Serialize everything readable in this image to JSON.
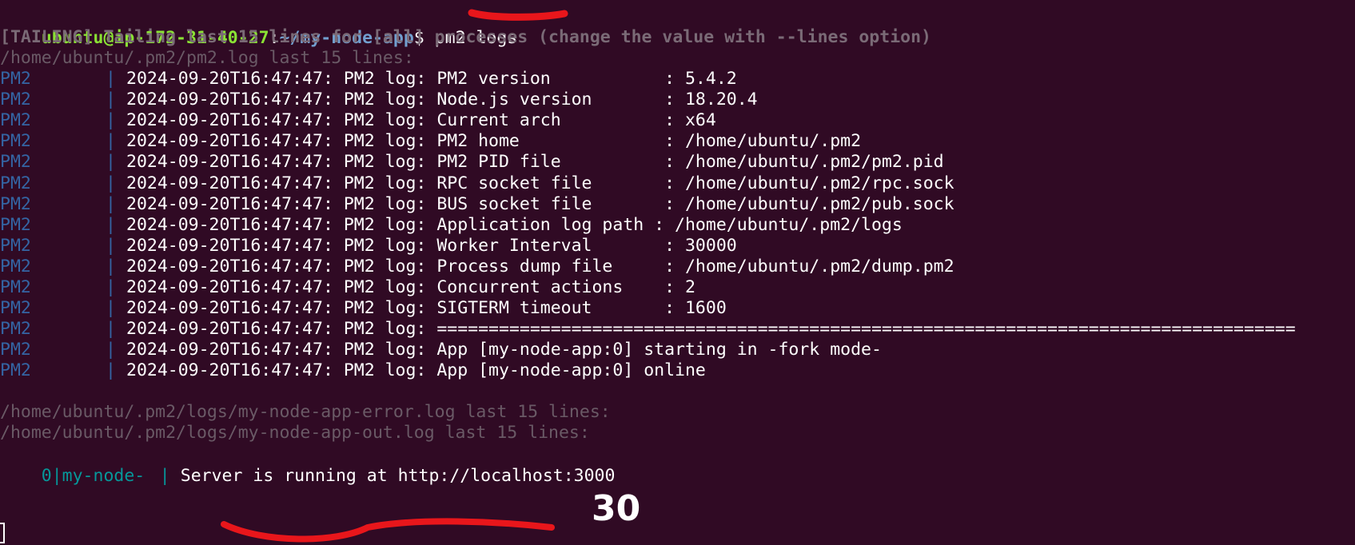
{
  "prompt": {
    "user_host": "ubuntu@ip-172-31-40-27",
    "separator": ":",
    "path": "~/my-node-app",
    "symbol": "$ ",
    "command": "pm2 logs"
  },
  "tailing_notice": "[TAILING] Tailing last 15 lines for [all] processes (change the value with --lines option)",
  "pm2_log_header": "/home/ubuntu/.pm2/pm2.log last 15 lines:",
  "pm2_tag": "PM2",
  "pipe": "|",
  "pm2_lines": [
    "2024-09-20T16:47:47: PM2 log: PM2 version           : 5.4.2",
    "2024-09-20T16:47:47: PM2 log: Node.js version       : 18.20.4",
    "2024-09-20T16:47:47: PM2 log: Current arch          : x64",
    "2024-09-20T16:47:47: PM2 log: PM2 home              : /home/ubuntu/.pm2",
    "2024-09-20T16:47:47: PM2 log: PM2 PID file          : /home/ubuntu/.pm2/pm2.pid",
    "2024-09-20T16:47:47: PM2 log: RPC socket file       : /home/ubuntu/.pm2/rpc.sock",
    "2024-09-20T16:47:47: PM2 log: BUS socket file       : /home/ubuntu/.pm2/pub.sock",
    "2024-09-20T16:47:47: PM2 log: Application log path : /home/ubuntu/.pm2/logs",
    "2024-09-20T16:47:47: PM2 log: Worker Interval       : 30000",
    "2024-09-20T16:47:47: PM2 log: Process dump file     : /home/ubuntu/.pm2/dump.pm2",
    "2024-09-20T16:47:47: PM2 log: Concurrent actions    : 2",
    "2024-09-20T16:47:47: PM2 log: SIGTERM timeout       : 1600",
    "2024-09-20T16:47:47: PM2 log: ===================================================================================",
    "2024-09-20T16:47:47: PM2 log: App [my-node-app:0] starting in -fork mode-",
    "2024-09-20T16:47:47: PM2 log: App [my-node-app:0] online"
  ],
  "error_log_header": "/home/ubuntu/.pm2/logs/my-node-app-error.log last 15 lines:",
  "out_log_header": "/home/ubuntu/.pm2/logs/my-node-app-out.log last 15 lines:",
  "app_tag": "0|my-node-",
  "app_line": "Server is running at http://localhost:3000",
  "annotation_number": "30",
  "colors": {
    "background": "#300a24",
    "prompt_user": "#8ae234",
    "prompt_path": "#729fcf",
    "pm2_tag": "#3465a4",
    "app_tag": "#06989a",
    "annotation_stroke": "#e8161b"
  }
}
